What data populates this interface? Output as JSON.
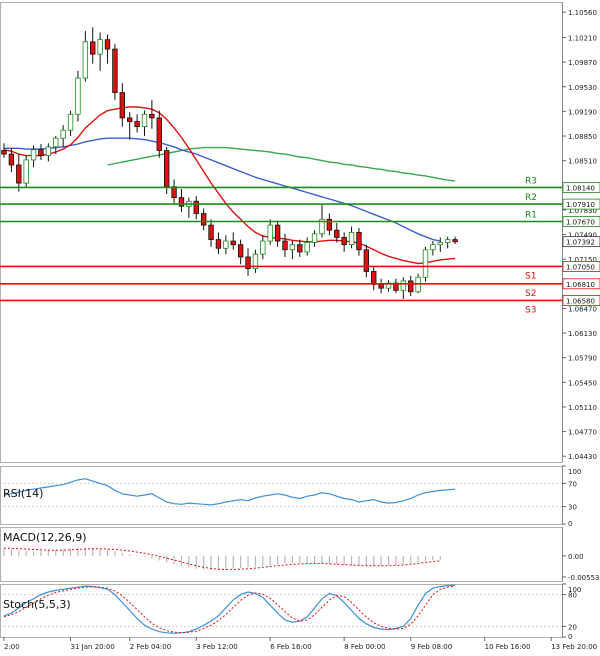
{
  "chart_data": {
    "type": "candlestick",
    "price_panel": {
      "yticks": [
        "1.10560",
        "1.10210",
        "1.09870",
        "1.09530",
        "1.09190",
        "1.08850",
        "1.08510",
        "1.08170",
        "1.07830",
        "1.07490",
        "1.07150",
        "1.06470",
        "1.06130",
        "1.05790",
        "1.05450",
        "1.05110",
        "1.04770",
        "1.04430"
      ],
      "ylim": [
        1.0435,
        1.107
      ],
      "current_price": "1.07392",
      "levels": [
        {
          "label": "R3",
          "value": 1.0814,
          "text": "1.08140",
          "color": "#1a8c1a"
        },
        {
          "label": "R2",
          "value": 1.0791,
          "text": "1.07910",
          "color": "#1a8c1a"
        },
        {
          "label": "R1",
          "value": 1.0767,
          "text": "1.07670",
          "color": "#1a8c1a"
        },
        {
          "label": "S1",
          "value": 1.0705,
          "text": "1.07050",
          "color": "#e01010"
        },
        {
          "label": "S2",
          "value": 1.0681,
          "text": "1.06810",
          "color": "#e01010"
        },
        {
          "label": "S3",
          "value": 1.0658,
          "text": "1.06580",
          "color": "#e01010"
        }
      ],
      "candles": [
        [
          1.0865,
          1.0875,
          1.0855,
          1.086
        ],
        [
          1.086,
          1.0868,
          1.0835,
          1.0845
        ],
        [
          1.0845,
          1.086,
          1.0808,
          1.082
        ],
        [
          1.082,
          1.0858,
          1.0815,
          1.0852
        ],
        [
          1.0852,
          1.0872,
          1.0842,
          1.0866
        ],
        [
          1.0866,
          1.0874,
          1.0852,
          1.0858
        ],
        [
          1.0858,
          1.0875,
          1.085,
          1.087
        ],
        [
          1.087,
          1.0885,
          1.086,
          1.0882
        ],
        [
          1.0882,
          1.09,
          1.087,
          1.0893
        ],
        [
          1.0893,
          1.092,
          1.0885,
          1.0915
        ],
        [
          1.0915,
          1.0975,
          1.0905,
          1.0965
        ],
        [
          1.0965,
          1.103,
          1.096,
          1.1015
        ],
        [
          1.1015,
          1.1035,
          1.0985,
          1.0998
        ],
        [
          1.0998,
          1.1028,
          1.0975,
          1.1018
        ],
        [
          1.1018,
          1.1025,
          1.0985,
          1.1005
        ],
        [
          1.1005,
          1.1012,
          1.0935,
          1.0945
        ],
        [
          1.0945,
          1.0958,
          1.0898,
          1.091
        ],
        [
          1.091,
          1.0918,
          1.088,
          1.0905
        ],
        [
          1.0905,
          1.0915,
          1.089,
          1.0898
        ],
        [
          1.0898,
          1.092,
          1.0885,
          1.0915
        ],
        [
          1.0915,
          1.0935,
          1.0895,
          1.091
        ],
        [
          1.091,
          1.092,
          1.0855,
          1.0865
        ],
        [
          1.0865,
          1.087,
          1.0805,
          1.0815
        ],
        [
          1.0815,
          1.0825,
          1.0792,
          1.08
        ],
        [
          1.08,
          1.0812,
          1.078,
          1.0788
        ],
        [
          1.0788,
          1.08,
          1.0772,
          1.0795
        ],
        [
          1.0795,
          1.0802,
          1.077,
          1.0778
        ],
        [
          1.0778,
          1.0785,
          1.0755,
          1.0762
        ],
        [
          1.0762,
          1.077,
          1.0732,
          1.0742
        ],
        [
          1.0742,
          1.0752,
          1.0722,
          1.073
        ],
        [
          1.073,
          1.0748,
          1.0722,
          1.074
        ],
        [
          1.074,
          1.0752,
          1.0728,
          1.0735
        ],
        [
          1.0735,
          1.0742,
          1.0708,
          1.0718
        ],
        [
          1.0718,
          1.073,
          1.0692,
          1.0702
        ],
        [
          1.0702,
          1.0728,
          1.0696,
          1.0722
        ],
        [
          1.0722,
          1.0748,
          1.0715,
          1.074
        ],
        [
          1.074,
          1.077,
          1.0735,
          1.0762
        ],
        [
          1.0762,
          1.0768,
          1.0732,
          1.074
        ],
        [
          1.074,
          1.075,
          1.0718,
          1.0728
        ],
        [
          1.0728,
          1.074,
          1.0715,
          1.0735
        ],
        [
          1.0735,
          1.0742,
          1.0718,
          1.0725
        ],
        [
          1.0725,
          1.0745,
          1.072,
          1.0738
        ],
        [
          1.0738,
          1.0755,
          1.0732,
          1.075
        ],
        [
          1.075,
          1.079,
          1.0745,
          1.077
        ],
        [
          1.077,
          1.0778,
          1.0748,
          1.0755
        ],
        [
          1.0755,
          1.0765,
          1.0738,
          1.0745
        ],
        [
          1.0745,
          1.0752,
          1.0725,
          1.0735
        ],
        [
          1.0735,
          1.076,
          1.073,
          1.0752
        ],
        [
          1.0752,
          1.0758,
          1.072,
          1.0728
        ],
        [
          1.0728,
          1.0735,
          1.069,
          1.0698
        ],
        [
          1.0698,
          1.0705,
          1.0672,
          1.068
        ],
        [
          1.068,
          1.0688,
          1.0668,
          1.0675
        ],
        [
          1.0675,
          1.0686,
          1.067,
          1.0682
        ],
        [
          1.0682,
          1.0688,
          1.0668,
          1.0672
        ],
        [
          1.0672,
          1.069,
          1.066,
          1.0685
        ],
        [
          1.0685,
          1.0692,
          1.0664,
          1.067
        ],
        [
          1.067,
          1.0695,
          1.0668,
          1.069
        ],
        [
          1.069,
          1.0732,
          1.0684,
          1.0728
        ],
        [
          1.0728,
          1.074,
          1.072,
          1.0735
        ],
        [
          1.0735,
          1.0745,
          1.0725,
          1.0738
        ],
        [
          1.0738,
          1.0746,
          1.073,
          1.0742
        ],
        [
          1.0742,
          1.0746,
          1.0736,
          1.0739
        ]
      ],
      "ma_red": [
        1.0866,
        1.0864,
        1.086,
        1.0858,
        1.0858,
        1.0858,
        1.086,
        1.0863,
        1.0867,
        1.0873,
        1.0883,
        1.0896,
        1.0905,
        1.0914,
        1.092,
        1.0922,
        1.0924,
        1.0925,
        1.0925,
        1.0924,
        1.0922,
        1.0917,
        1.0908,
        1.0896,
        1.0883,
        1.0868,
        1.0852,
        1.0836,
        1.082,
        1.0806,
        1.0792,
        1.078,
        1.077,
        1.076,
        1.0752,
        1.0747,
        1.0745,
        1.0744,
        1.0743,
        1.0741,
        1.074,
        1.0739,
        1.0739,
        1.074,
        1.0741,
        1.0741,
        1.074,
        1.0739,
        1.0737,
        1.0733,
        1.0728,
        1.0723,
        1.0719,
        1.0716,
        1.0713,
        1.0711,
        1.0709,
        1.071,
        1.0712,
        1.0714,
        1.0715,
        1.0716
      ],
      "ma_blue": [
        1.0868,
        1.0868,
        1.0868,
        1.0867,
        1.0867,
        1.0867,
        1.0868,
        1.0869,
        1.087,
        1.0872,
        1.0874,
        1.0877,
        1.0879,
        1.0881,
        1.0882,
        1.0882,
        1.0882,
        1.0882,
        1.0881,
        1.088,
        1.0878,
        1.0876,
        1.0873,
        1.087,
        1.0866,
        1.0863,
        1.086,
        1.0856,
        1.0852,
        1.0848,
        1.0844,
        1.084,
        1.0836,
        1.0832,
        1.0828,
        1.0825,
        1.0822,
        1.0819,
        1.0816,
        1.0813,
        1.081,
        1.0807,
        1.0804,
        1.0801,
        1.0798,
        1.0795,
        1.0792,
        1.0789,
        1.0785,
        1.0781,
        1.0777,
        1.0773,
        1.0769,
        1.0765,
        1.076,
        1.0755,
        1.075,
        1.0746,
        1.0742,
        1.074
      ],
      "ma_green": [
        1.0845,
        1.0847,
        1.0849,
        1.0851,
        1.0853,
        1.0855,
        1.0857,
        1.0859,
        1.0861,
        1.0863,
        1.0865,
        1.0867,
        1.0868,
        1.0869,
        1.0869,
        1.0869,
        1.0869,
        1.0868,
        1.0867,
        1.0866,
        1.0865,
        1.0864,
        1.0863,
        1.0861,
        1.086,
        1.0858,
        1.0856,
        1.0855,
        1.0853,
        1.0851,
        1.0849,
        1.0848,
        1.0846,
        1.0845,
        1.0843,
        1.0842,
        1.084,
        1.0839,
        1.0837,
        1.0836,
        1.0834,
        1.0833,
        1.0831,
        1.083,
        1.0828,
        1.0826,
        1.0824,
        1.0823
      ]
    },
    "rsi_panel": {
      "label": "RSI(14)",
      "yticks": [
        "100",
        "70",
        "30",
        "0"
      ],
      "ylim": [
        0,
        100
      ],
      "values": [
        50,
        52,
        55,
        58,
        60,
        62,
        64,
        66,
        68,
        72,
        76,
        78,
        74,
        70,
        66,
        58,
        52,
        50,
        48,
        50,
        52,
        45,
        38,
        35,
        34,
        36,
        35,
        34,
        33,
        35,
        38,
        40,
        42,
        40,
        45,
        48,
        50,
        52,
        50,
        46,
        44,
        48,
        50,
        54,
        52,
        48,
        44,
        42,
        38,
        40,
        42,
        38,
        36,
        37,
        40,
        44,
        50,
        54,
        56,
        58,
        59,
        60
      ]
    },
    "macd_panel": {
      "label": "MACD(12,26,9)",
      "yticks": [
        "0.00",
        "-0.005537"
      ],
      "ylim": [
        -0.0066,
        0.0076
      ],
      "histogram": [
        0.002,
        0.0018,
        0.0015,
        0.0013,
        0.0012,
        0.0012,
        0.0013,
        0.0015,
        0.0017,
        0.0019,
        0.0021,
        0.0022,
        0.0021,
        0.0019,
        0.0016,
        0.0012,
        0.0008,
        0.0004,
        0.0001,
        -0.0003,
        -0.0007,
        -0.0012,
        -0.0017,
        -0.0022,
        -0.0027,
        -0.0031,
        -0.0034,
        -0.0036,
        -0.0037,
        -0.0037,
        -0.0036,
        -0.0034,
        -0.0032,
        -0.003,
        -0.0028,
        -0.0026,
        -0.0024,
        -0.0022,
        -0.002,
        -0.0019,
        -0.0018,
        -0.0018,
        -0.0019,
        -0.002,
        -0.0021,
        -0.0022,
        -0.0023,
        -0.0024,
        -0.0025,
        -0.0026,
        -0.0026,
        -0.0026,
        -0.0025,
        -0.0024,
        -0.0022,
        -0.0019,
        -0.0016,
        -0.0013,
        -0.0011,
        -0.001
      ],
      "signal": [
        0.002,
        0.002,
        0.0019,
        0.0018,
        0.0017,
        0.0016,
        0.0015,
        0.0015,
        0.0015,
        0.0016,
        0.0017,
        0.0018,
        0.0019,
        0.0019,
        0.0018,
        0.0017,
        0.0015,
        0.0013,
        0.001,
        0.0007,
        0.0003,
        -0.0001,
        -0.0006,
        -0.0011,
        -0.0016,
        -0.0021,
        -0.0026,
        -0.003,
        -0.0033,
        -0.0035,
        -0.0036,
        -0.0036,
        -0.0035,
        -0.0034,
        -0.0032,
        -0.003,
        -0.0028,
        -0.0026,
        -0.0024,
        -0.0022,
        -0.0021,
        -0.002,
        -0.002,
        -0.002,
        -0.0021,
        -0.0022,
        -0.0023,
        -0.0024,
        -0.0025,
        -0.0026,
        -0.0026,
        -0.0026,
        -0.0026,
        -0.0025,
        -0.0024,
        -0.0022,
        -0.002,
        -0.0017,
        -0.0015,
        -0.0013
      ]
    },
    "stoch_panel": {
      "label": "Stoch(5,5,3)",
      "yticks": [
        "100",
        "80",
        "20",
        "0"
      ],
      "ylim": [
        0,
        100
      ],
      "main": [
        40,
        45,
        55,
        65,
        72,
        80,
        85,
        88,
        90,
        92,
        94,
        96,
        95,
        93,
        90,
        80,
        65,
        50,
        35,
        22,
        15,
        10,
        8,
        7,
        8,
        10,
        15,
        22,
        30,
        40,
        55,
        70,
        80,
        85,
        82,
        75,
        60,
        45,
        32,
        28,
        30,
        38,
        55,
        72,
        82,
        78,
        65,
        50,
        35,
        25,
        18,
        15,
        14,
        16,
        20,
        35,
        60,
        82,
        92,
        95,
        97,
        98
      ],
      "signal": [
        38,
        42,
        48,
        56,
        64,
        72,
        79,
        84,
        87,
        90,
        92,
        94,
        95,
        94,
        92,
        87,
        78,
        65,
        52,
        38,
        26,
        17,
        12,
        9,
        8,
        9,
        11,
        16,
        22,
        31,
        42,
        56,
        69,
        79,
        83,
        81,
        73,
        61,
        48,
        36,
        30,
        32,
        42,
        56,
        70,
        78,
        76,
        65,
        51,
        38,
        27,
        20,
        16,
        15,
        16,
        24,
        40,
        60,
        80,
        90,
        94,
        96
      ]
    },
    "xticks": [
      {
        "label": "2:00",
        "i": 0
      },
      {
        "label": "31 Jan 20:00",
        "i": 9
      },
      {
        "label": "2 Feb 04:00",
        "i": 17
      },
      {
        "label": "3 Feb 12:00",
        "i": 26
      },
      {
        "label": "6 Feb 16:00",
        "i": 36
      },
      {
        "label": "8 Feb 00:00",
        "i": 46
      },
      {
        "label": "9 Feb 08:00",
        "i": 55
      },
      {
        "label": "10 Feb 16:00",
        "i": 65
      },
      {
        "label": "13 Feb 20:00",
        "i": 74
      }
    ]
  },
  "colors": {
    "bull": "#1a8c1a",
    "bear": "#e01010",
    "ma_red": "#e01010",
    "ma_blue": "#3b5fcf",
    "ma_green": "#3aa84a",
    "rsi": "#3b8fd8",
    "grid": "#e6e6e6",
    "frame": "#b0b0b0",
    "price_label_bg": "#ffffff"
  }
}
